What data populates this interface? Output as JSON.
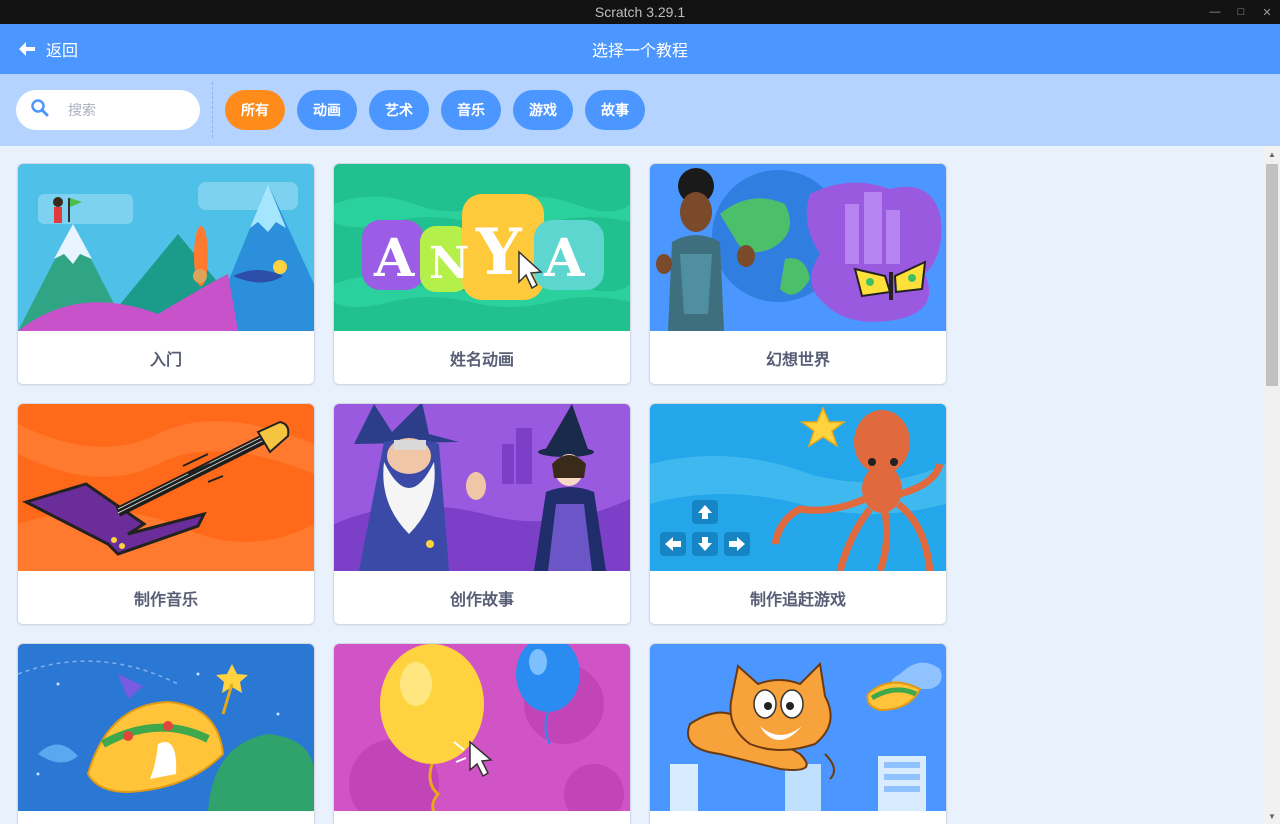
{
  "window": {
    "title": "Scratch 3.29.1"
  },
  "header": {
    "back_label": "返回",
    "title": "选择一个教程"
  },
  "search": {
    "placeholder": "搜索"
  },
  "tags": [
    {
      "label": "所有",
      "active": true
    },
    {
      "label": "动画"
    },
    {
      "label": "艺术"
    },
    {
      "label": "音乐"
    },
    {
      "label": "游戏"
    },
    {
      "label": "故事"
    }
  ],
  "cards": [
    {
      "title": "入门"
    },
    {
      "title": "姓名动画"
    },
    {
      "title": "幻想世界"
    },
    {
      "title": "制作音乐"
    },
    {
      "title": "创作故事"
    },
    {
      "title": "制作追赶游戏"
    },
    {
      "title": ""
    },
    {
      "title": ""
    },
    {
      "title": ""
    }
  ],
  "thumb_text": {
    "anya": "ANYA"
  },
  "colors": {
    "header": "#4c97ff",
    "filterbar": "#b4d3ff",
    "active_tag": "#ff8c1a",
    "tag": "#4c97ff"
  }
}
